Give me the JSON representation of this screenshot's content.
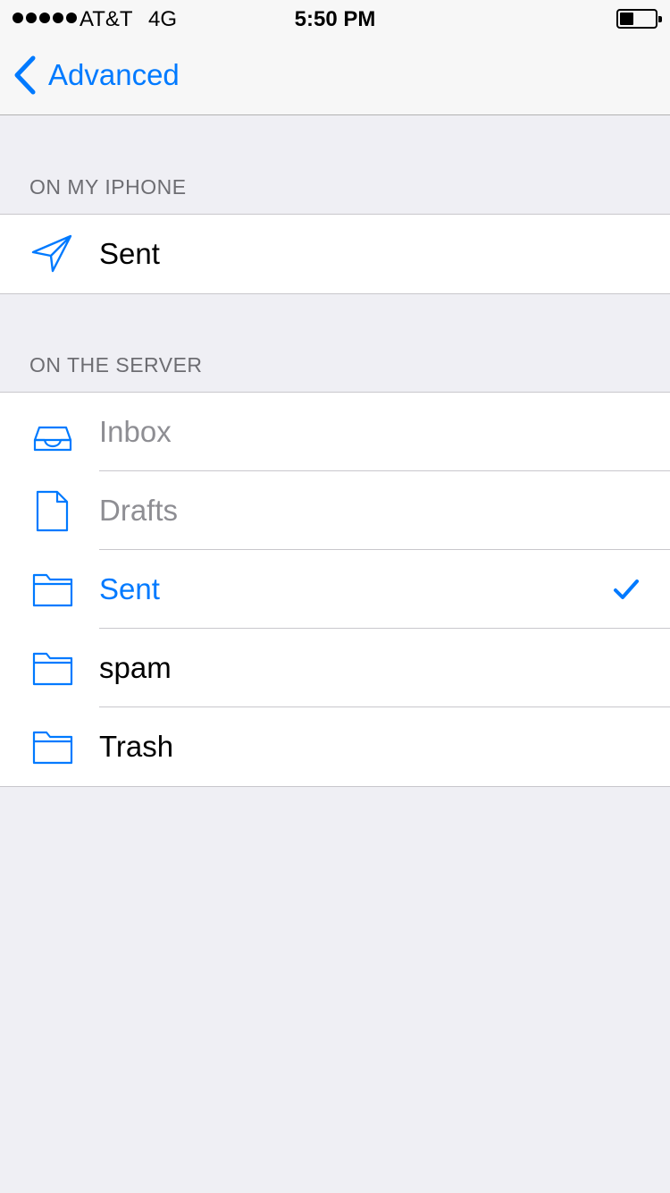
{
  "status_bar": {
    "carrier": "AT&T",
    "network": "4G",
    "time": "5:50 PM",
    "battery_level": 0.4
  },
  "nav": {
    "back_label": "Advanced",
    "back_icon": "chevron-left-icon"
  },
  "colors": {
    "accent": "#007aff",
    "disabled_text": "#8e8e93",
    "section_header": "#6d6d72",
    "background": "#efeff4"
  },
  "sections": [
    {
      "header": "ON MY IPHONE",
      "rows": [
        {
          "label": "Sent",
          "icon": "paper-plane-icon",
          "state": "normal",
          "checked": false
        }
      ]
    },
    {
      "header": "ON THE SERVER",
      "rows": [
        {
          "label": "Inbox",
          "icon": "inbox-tray-icon",
          "state": "disabled",
          "checked": false
        },
        {
          "label": "Drafts",
          "icon": "document-icon",
          "state": "disabled",
          "checked": false
        },
        {
          "label": "Sent",
          "icon": "folder-icon",
          "state": "selected",
          "checked": true
        },
        {
          "label": "spam",
          "icon": "folder-icon",
          "state": "normal",
          "checked": false
        },
        {
          "label": "Trash",
          "icon": "folder-icon",
          "state": "normal",
          "checked": false
        }
      ]
    }
  ]
}
